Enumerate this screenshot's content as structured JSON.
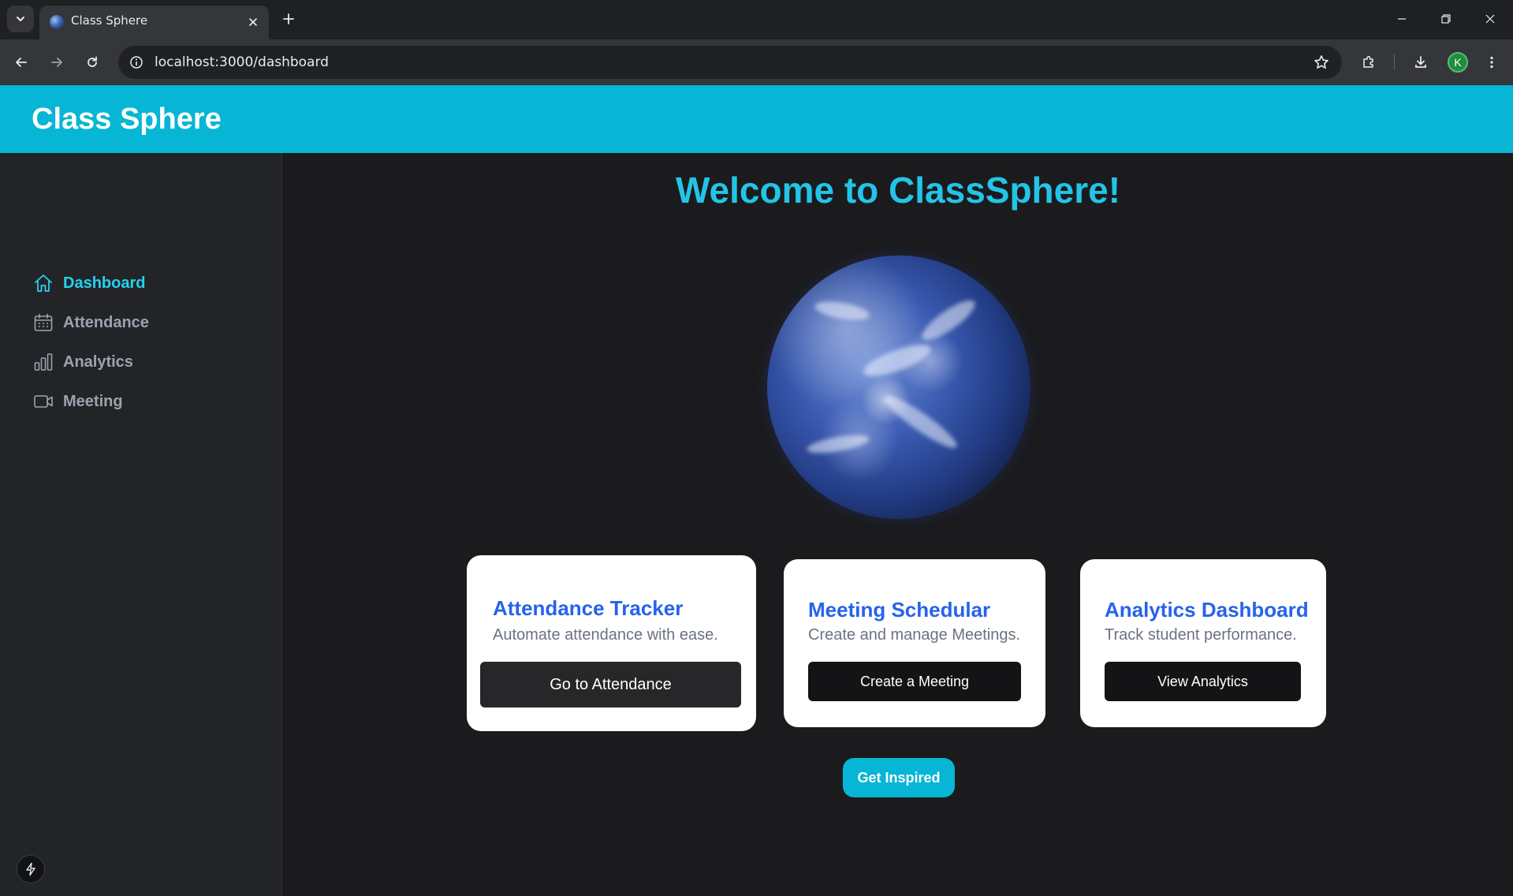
{
  "browser": {
    "tab_title": "Class Sphere",
    "url": "localhost:3000/dashboard",
    "profile_initial": "K"
  },
  "app": {
    "title": "Class Sphere",
    "accent_color": "#06b6d4"
  },
  "sidebar": {
    "items": [
      {
        "label": "Dashboard",
        "icon": "home-icon",
        "active": true
      },
      {
        "label": "Attendance",
        "icon": "calendar-icon",
        "active": false
      },
      {
        "label": "Analytics",
        "icon": "bar-chart-icon",
        "active": false
      },
      {
        "label": "Meeting",
        "icon": "video-camera-icon",
        "active": false
      }
    ]
  },
  "main": {
    "welcome": "Welcome to ClassSphere!",
    "cards": [
      {
        "title": "Attendance Tracker",
        "description": "Automate attendance with ease.",
        "button": "Go to Attendance"
      },
      {
        "title": "Meeting Schedular",
        "description": "Create and manage Meetings.",
        "button": "Create a Meeting"
      },
      {
        "title": "Analytics Dashboard",
        "description": "Track student performance.",
        "button": "View Analytics"
      }
    ],
    "inspire_button": "Get Inspired"
  }
}
